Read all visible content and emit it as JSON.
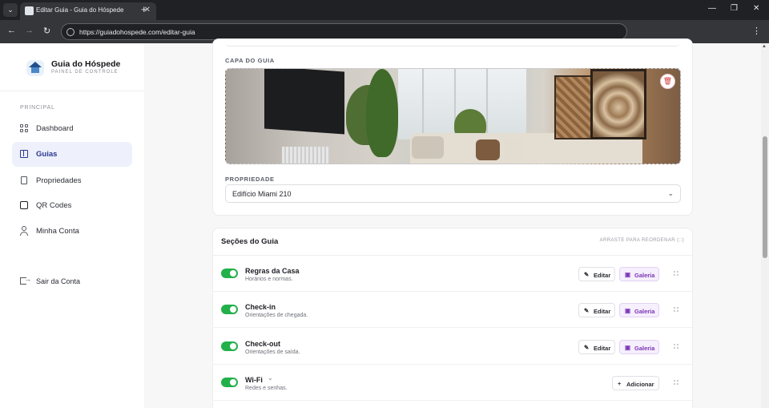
{
  "browser": {
    "tab_title": "Editar Guia - Guia do Hóspede",
    "url": "https://guiadohospede.com/editar-guia",
    "icons": {
      "tab_list": "chevron-down-icon",
      "tab_close": "close-icon",
      "new_tab": "plus-icon",
      "back": "arrow-left-icon",
      "forward": "arrow-right-icon",
      "reload": "reload-icon",
      "site_info": "site-info-icon",
      "menu": "kebab-icon",
      "minimize": "minimize-icon",
      "restore": "restore-icon",
      "close_window": "close-icon"
    }
  },
  "sidebar": {
    "brand": "Guia do Hóspede",
    "brand_sub": "PAINEL DE CONTROLE",
    "section": "PRINCIPAL",
    "items": [
      {
        "label": "Dashboard",
        "icon": "grid-icon",
        "active": false
      },
      {
        "label": "Guias",
        "icon": "book-icon",
        "active": true
      },
      {
        "label": "Propriedades",
        "icon": "building-icon",
        "active": false
      },
      {
        "label": "QR Codes",
        "icon": "qr-code-icon",
        "active": false
      },
      {
        "label": "Minha Conta",
        "icon": "user-icon",
        "active": false
      }
    ],
    "logout": "Sair da Conta"
  },
  "cover": {
    "label": "CAPA DO GUIA",
    "delete_icon": "trash-icon"
  },
  "property": {
    "label": "PROPRIEDADE",
    "value": "Edifício Miami 210"
  },
  "sections": {
    "title": "Seções do Guia",
    "hint": "ARRASTE PARA REORDENAR (::)",
    "edit_label": "Editar",
    "gallery_label": "Galeria",
    "add_label": "Adicionar",
    "rows": [
      {
        "title": "Regras da Casa",
        "desc": "Horários e normas.",
        "enabled": true
      },
      {
        "title": "Check-in",
        "desc": "Orientações de chegada.",
        "enabled": true
      },
      {
        "title": "Check-out",
        "desc": "Orientações de saída.",
        "enabled": true
      },
      {
        "title": "Wi-Fi",
        "desc": "Redes e senhas.",
        "enabled": true
      }
    ]
  },
  "colors": {
    "accent": "#2c3a8f",
    "toggle_on": "#22b04b",
    "gallery": "#7b35b6",
    "danger": "#d23a3a"
  }
}
